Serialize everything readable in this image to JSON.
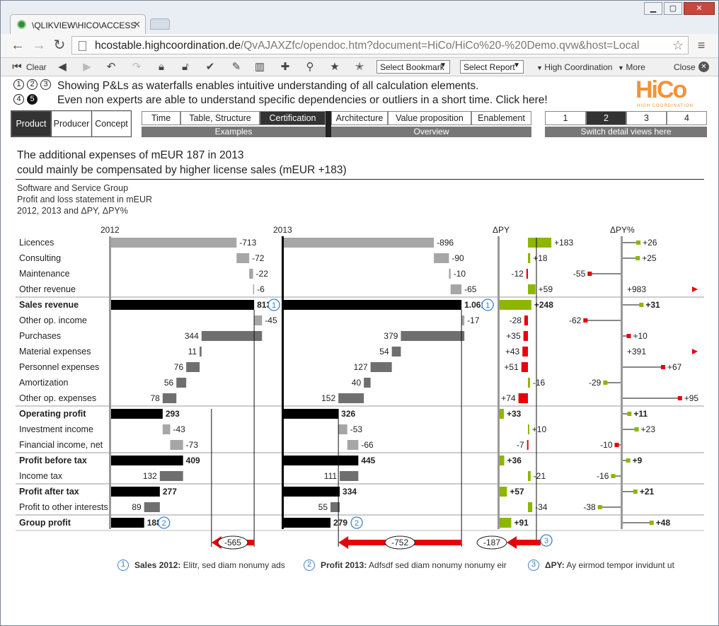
{
  "browser": {
    "tab_title": "\\QLIKVIEW\\HICO\\ACCESS",
    "url_host": "hcostable.highcoordination.de",
    "url_rest": "/QvAJAXZfc/opendoc.htm?document=HiCo/HiCo%20-%20Demo.qvw&host=Local"
  },
  "toolbar": {
    "clear": "Clear",
    "bookmark": "Select Bookmark",
    "report": "Select Report",
    "hico": "High Coordination",
    "more": "More",
    "close": "Close"
  },
  "info": {
    "circles": [
      "1",
      "2",
      "3",
      "4",
      "5"
    ],
    "line1": "Showing P&Ls as waterfalls enables intuitive understanding of all calculation elements.",
    "line2": "Even non experts are able to understand specific dependencies or outliers in a short time. Click here!",
    "logo": "HiCo",
    "logo_sub": "HIGH COORDINATION"
  },
  "nav": {
    "group1": [
      "Product",
      "Producer",
      "Concept"
    ],
    "group2": [
      "Time",
      "Table, Structure",
      "Certification"
    ],
    "group2_footer": "Examples",
    "group3": [
      "Architecture",
      "Value proposition",
      "Enablement"
    ],
    "group3_footer": "Overview",
    "group4": [
      "1",
      "2",
      "3",
      "4"
    ],
    "group4_footer": "Switch detail views here"
  },
  "headline": {
    "line1": "The additional expenses of mEUR 187 in 2013",
    "line2": "could mainly be compensated by higher license sales (mEUR +183)"
  },
  "subtitle": {
    "line1": "Software and Service Group",
    "line2": "Profit and loss statement in mEUR",
    "line3": "2012, 2013 and ΔPY, ΔPY%"
  },
  "columns": {
    "c2012": "2012",
    "c2013": "2013",
    "dpy": "ΔPY",
    "dpyp": "ΔPY%"
  },
  "colors": {
    "revenue": "#a6a6a6",
    "expense": "#6f6f6f",
    "total": "#000000",
    "pos": "#8db600",
    "neg": "#e8000b",
    "marker": "#3a83c6"
  },
  "chart_data": {
    "type": "waterfall-table",
    "rows": [
      {
        "label": "Licences",
        "bold": false,
        "kind": "rev",
        "v2012": 713,
        "l2012": "-713",
        "v2013": 896,
        "l2013": "-896",
        "dpy": 183,
        "ldpy": "+183",
        "dpyp": 26,
        "ldpyp": "+26"
      },
      {
        "label": "Consulting",
        "bold": false,
        "kind": "rev",
        "v2012": 72,
        "l2012": "-72",
        "v2013": 90,
        "l2013": "-90",
        "dpy": 18,
        "ldpy": "+18",
        "dpyp": 25,
        "ldpyp": "+25"
      },
      {
        "label": "Maintenance",
        "bold": false,
        "kind": "rev",
        "v2012": 22,
        "l2012": "-22",
        "v2013": 10,
        "l2013": "-10",
        "dpy": -12,
        "ldpy": "-12",
        "dpyp": -55,
        "ldpyp": "-55"
      },
      {
        "label": "Other revenue",
        "bold": false,
        "kind": "rev",
        "v2012": 6,
        "l2012": "-6",
        "v2013": 65,
        "l2013": "-65",
        "dpy": 59,
        "ldpy": "+59",
        "dpyp": 983,
        "ldpyp": "+983",
        "overflow": true
      },
      {
        "label": "Sales revenue",
        "bold": true,
        "kind": "total",
        "v2012": 813,
        "l2012": "813",
        "v2013": 1061,
        "l2013": "1.061",
        "dpy": 248,
        "ldpy": "+248",
        "dpyp": 31,
        "ldpyp": "+31",
        "sep": true,
        "marker": "1"
      },
      {
        "label": "Other op. income",
        "bold": false,
        "kind": "rev",
        "v2012": 45,
        "l2012": "-45",
        "v2013": 17,
        "l2013": "-17",
        "dpy": -28,
        "ldpy": "-28",
        "dpyp": -62,
        "ldpyp": "-62"
      },
      {
        "label": "Purchases",
        "bold": false,
        "kind": "exp",
        "v2012": 344,
        "l2012": "344",
        "v2013": 379,
        "l2013": "379",
        "dpy": -35,
        "ldpy": "+35",
        "dpyp": 10,
        "ldpyp": "+10"
      },
      {
        "label": "Material expenses",
        "bold": false,
        "kind": "exp",
        "v2012": 11,
        "l2012": "11",
        "v2013": 54,
        "l2013": "54",
        "dpy": -43,
        "ldpy": "+43",
        "dpyp": 391,
        "ldpyp": "+391",
        "overflow": true
      },
      {
        "label": "Personnel expenses",
        "bold": false,
        "kind": "exp",
        "v2012": 76,
        "l2012": "76",
        "v2013": 127,
        "l2013": "127",
        "dpy": -51,
        "ldpy": "+51",
        "dpyp": 67,
        "ldpyp": "+67"
      },
      {
        "label": "Amortization",
        "bold": false,
        "kind": "exp",
        "v2012": 56,
        "l2012": "56",
        "v2013": 40,
        "l2013": "40",
        "dpy": 16,
        "ldpy": "-16",
        "dpyp": -29,
        "ldpyp": "-29"
      },
      {
        "label": "Other op. expenses",
        "bold": false,
        "kind": "exp",
        "v2012": 78,
        "l2012": "78",
        "v2013": 152,
        "l2013": "152",
        "dpy": -74,
        "ldpy": "+74",
        "dpyp": 95,
        "ldpyp": "+95"
      },
      {
        "label": "Operating profit",
        "bold": true,
        "kind": "total",
        "v2012": 293,
        "l2012": "293",
        "v2013": 326,
        "l2013": "326",
        "dpy": 33,
        "ldpy": "+33",
        "dpyp": 11,
        "ldpyp": "+11",
        "sep": true
      },
      {
        "label": "Investment income",
        "bold": false,
        "kind": "rev",
        "v2012": 43,
        "l2012": "-43",
        "v2013": 53,
        "l2013": "-53",
        "dpy": 10,
        "ldpy": "+10",
        "dpyp": 23,
        "ldpyp": "+23"
      },
      {
        "label": "Financial income, net",
        "bold": false,
        "kind": "rev",
        "v2012": 73,
        "l2012": "-73",
        "v2013": 66,
        "l2013": "-66",
        "dpy": -7,
        "ldpy": "-7",
        "dpyp": -10,
        "ldpyp": "-10"
      },
      {
        "label": "Profit before tax",
        "bold": true,
        "kind": "total",
        "v2012": 409,
        "l2012": "409",
        "v2013": 445,
        "l2013": "445",
        "dpy": 36,
        "ldpy": "+36",
        "dpyp": 9,
        "ldpyp": "+9",
        "sep": true
      },
      {
        "label": "Income tax",
        "bold": false,
        "kind": "exp",
        "v2012": 132,
        "l2012": "132",
        "v2013": 111,
        "l2013": "111",
        "dpy": 21,
        "ldpy": "-21",
        "dpyp": -16,
        "ldpyp": "-16"
      },
      {
        "label": "Profit after tax",
        "bold": true,
        "kind": "total",
        "v2012": 277,
        "l2012": "277",
        "v2013": 334,
        "l2013": "334",
        "dpy": 57,
        "ldpy": "+57",
        "dpyp": 21,
        "ldpyp": "+21",
        "sep": true
      },
      {
        "label": "Profit to other interests",
        "bold": false,
        "kind": "exp",
        "v2012": 89,
        "l2012": "89",
        "v2013": 55,
        "l2013": "55",
        "dpy": 34,
        "ldpy": "-34",
        "dpyp": -38,
        "ldpyp": "-38"
      },
      {
        "label": "Group profit",
        "bold": true,
        "kind": "total",
        "v2012": 188,
        "l2012": "188",
        "v2013": 279,
        "l2013": "279",
        "dpy": 91,
        "ldpy": "+91",
        "dpyp": 48,
        "ldpyp": "+48",
        "sep": true,
        "marker": "2"
      }
    ],
    "arrows": {
      "a2012": "-565",
      "a2013": "-752",
      "adpy": "-187",
      "adpy_marker": "3"
    }
  },
  "footnotes": [
    {
      "num": "1",
      "title": "Sales 2012:",
      "text": "Elitr, sed diam nonumy ads"
    },
    {
      "num": "2",
      "title": "Profit 2013:",
      "text": "Adfsdf sed diam nonumy nonumy eir"
    },
    {
      "num": "3",
      "title": "ΔPY:",
      "text": "Ay eirmod tempor invidunt ut"
    }
  ]
}
